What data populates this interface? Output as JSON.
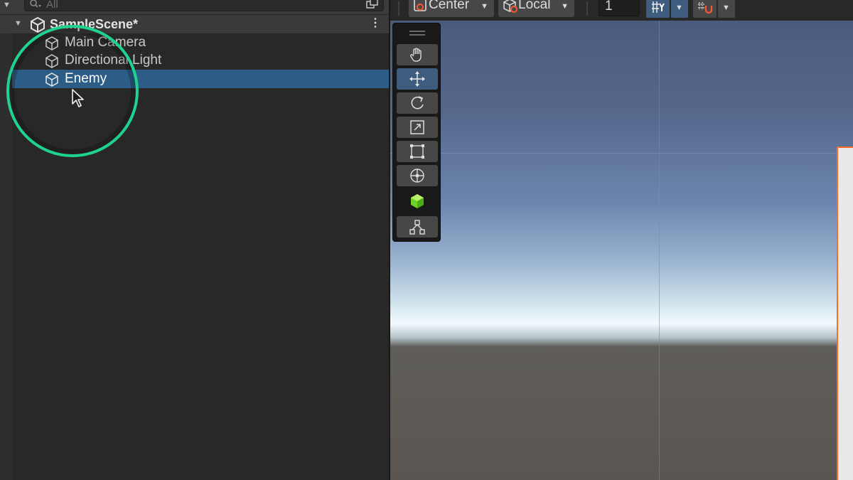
{
  "hierarchy": {
    "search": {
      "placeholder": "All",
      "icon": "search-icon"
    },
    "scene": {
      "name": "SampleScene*",
      "icon": "unity-scene-icon"
    },
    "items": [
      {
        "label": "Main Camera",
        "icon": "gameobject-cube-icon",
        "selected": false
      },
      {
        "label": "Directional Light",
        "icon": "gameobject-cube-icon",
        "selected": false
      },
      {
        "label": "Enemy",
        "icon": "gameobject-cube-icon",
        "selected": true
      }
    ],
    "highlight_color": "#1fd38f",
    "selection_color": "#2c5d87"
  },
  "scene_toolbar": {
    "pivot_label": "Center",
    "handle_label": "Local",
    "snap_value": "1"
  },
  "tools": [
    {
      "name": "hand-tool",
      "icon": "hand-icon",
      "active": false
    },
    {
      "name": "move-tool",
      "icon": "move-arrows-icon",
      "active": true
    },
    {
      "name": "rotate-tool",
      "icon": "rotate-icon",
      "active": false
    },
    {
      "name": "scale-tool",
      "icon": "scale-icon",
      "active": false
    },
    {
      "name": "rect-tool",
      "icon": "rect-transform-icon",
      "active": false
    },
    {
      "name": "transform-tool",
      "icon": "transform-icon",
      "active": false
    },
    {
      "name": "custom-tool",
      "icon": "green-cube-icon",
      "active": false
    },
    {
      "name": "component-tool",
      "icon": "tree-nodes-icon",
      "active": false
    }
  ],
  "viewport": {
    "selected_outline_color": "#ff6a2a"
  }
}
